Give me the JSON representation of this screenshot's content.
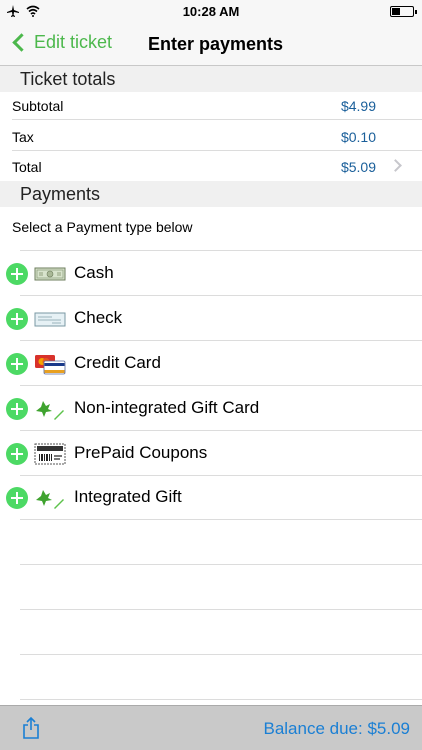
{
  "status_bar": {
    "time": "10:28 AM"
  },
  "nav": {
    "back_label": "Edit ticket",
    "title": "Enter payments"
  },
  "ticket_totals": {
    "header": "Ticket totals",
    "rows": [
      {
        "label": "Subtotal",
        "value": "$4.99"
      },
      {
        "label": "Tax",
        "value": "$0.10"
      },
      {
        "label": "Total",
        "value": "$5.09"
      }
    ]
  },
  "payments": {
    "header": "Payments",
    "instruction": "Select a Payment type below",
    "types": [
      {
        "label": "Cash",
        "icon": "cash-icon"
      },
      {
        "label": "Check",
        "icon": "check-icon"
      },
      {
        "label": "Credit Card",
        "icon": "credit-card-icon"
      },
      {
        "label": "Non-integrated Gift Card",
        "icon": "gift-card-icon"
      },
      {
        "label": "PrePaid Coupons",
        "icon": "coupon-icon"
      },
      {
        "label": "Integrated Gift",
        "icon": "gift-card-icon"
      }
    ]
  },
  "toolbar": {
    "balance_label": "Balance due: $5.09"
  },
  "colors": {
    "accent_green": "#4cb84c",
    "add_green": "#4cd964",
    "value_blue": "#1a5f9a",
    "balance_blue": "#1a7fd4"
  }
}
